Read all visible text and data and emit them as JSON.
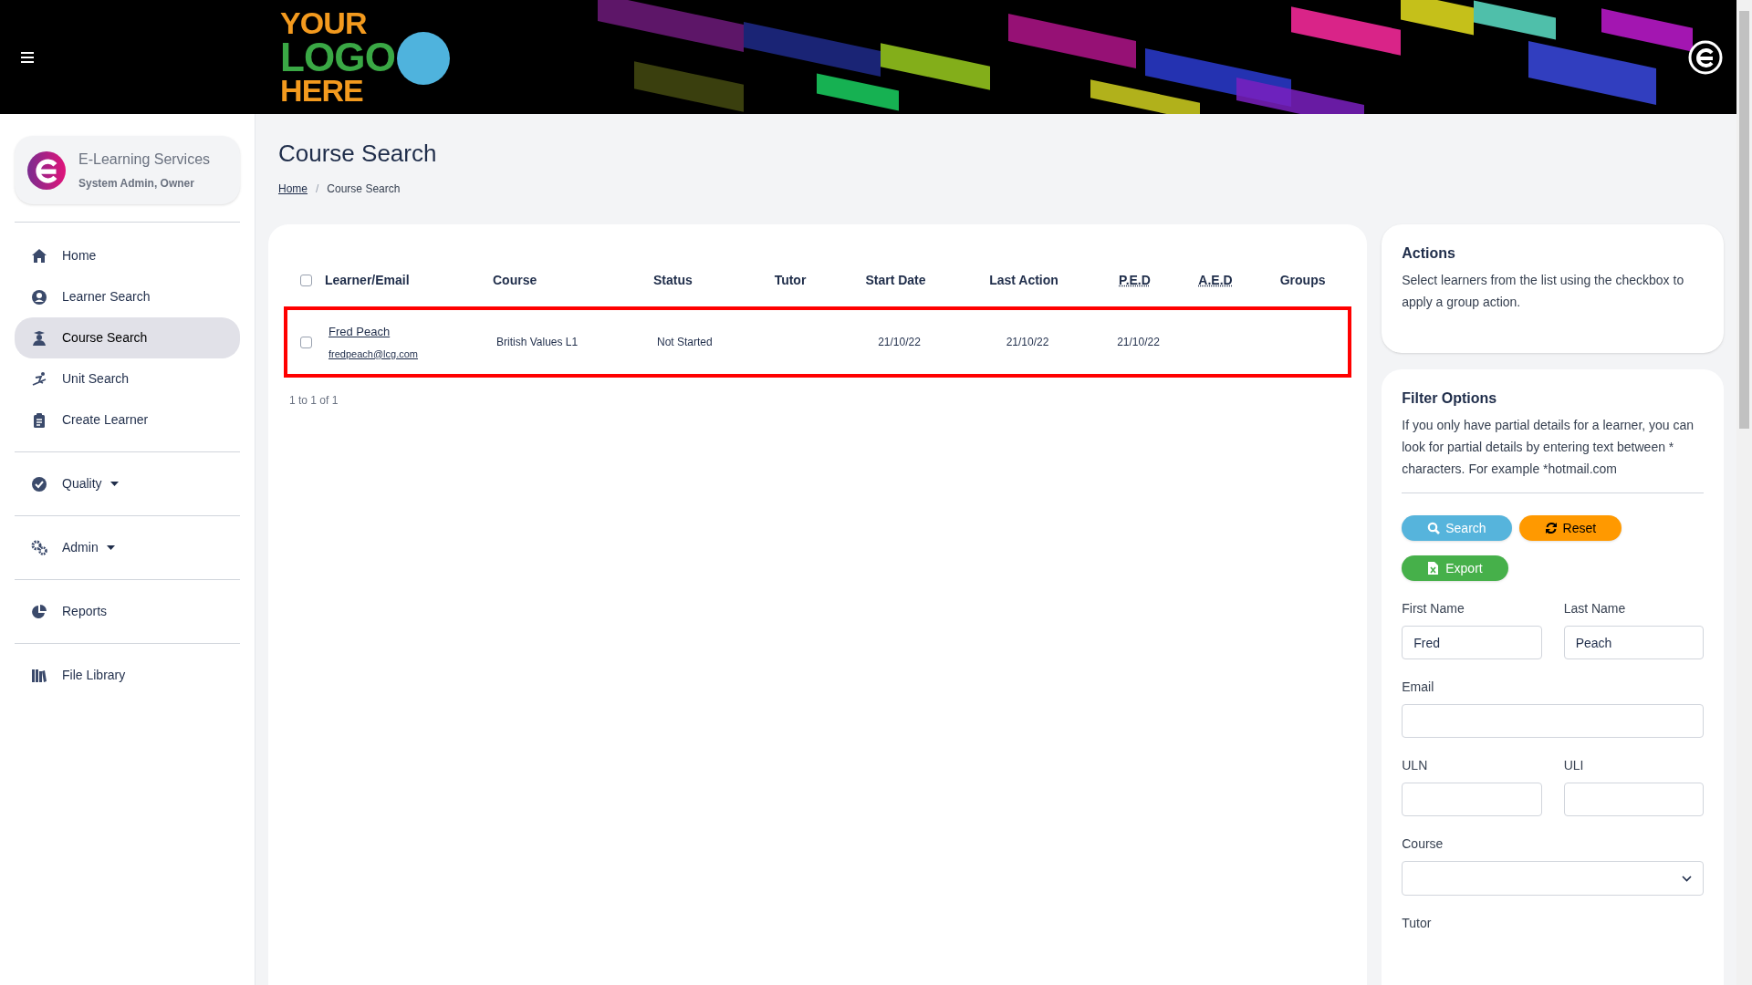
{
  "header": {
    "logo_lines": [
      "YOUR",
      "LOGO",
      "HERE"
    ]
  },
  "profile": {
    "name": "E-Learning Services",
    "role": "System Admin, Owner"
  },
  "sidebar": {
    "groups": [
      [
        {
          "label": "Home",
          "selected": false,
          "kind": "link"
        },
        {
          "label": "Learner Search",
          "selected": false,
          "kind": "link"
        },
        {
          "label": "Course Search",
          "selected": true,
          "kind": "link"
        },
        {
          "label": "Unit Search",
          "selected": false,
          "kind": "link"
        },
        {
          "label": "Create Learner",
          "selected": false,
          "kind": "link"
        }
      ],
      [
        {
          "label": "Quality",
          "selected": false,
          "kind": "dropdown"
        }
      ],
      [
        {
          "label": "Admin",
          "selected": false,
          "kind": "dropdown"
        }
      ],
      [
        {
          "label": "Reports",
          "selected": false,
          "kind": "link"
        }
      ],
      [
        {
          "label": "File Library",
          "selected": false,
          "kind": "link"
        }
      ]
    ]
  },
  "page": {
    "title": "Course Search",
    "breadcrumb": [
      {
        "label": "Home",
        "kind": "link"
      },
      {
        "label": "/",
        "kind": "separator"
      },
      {
        "label": "Course Search",
        "kind": "current"
      }
    ]
  },
  "table": {
    "select_all_checked": false,
    "columns": [
      {
        "label": "Learner/Email",
        "kind": "text"
      },
      {
        "label": "Course",
        "kind": "text"
      },
      {
        "label": "Status",
        "kind": "text"
      },
      {
        "label": "Tutor",
        "kind": "text"
      },
      {
        "label": "Start Date",
        "kind": "text"
      },
      {
        "label": "Last Action",
        "kind": "text"
      },
      {
        "label": "P.E.D",
        "kind": "abbr"
      },
      {
        "label": "A.E.D",
        "kind": "abbr"
      },
      {
        "label": "Groups",
        "kind": "text"
      }
    ],
    "rows": [
      {
        "checked": false,
        "highlighted": true,
        "name": "Fred Peach",
        "email": "fredpeach@lcg.com",
        "course": "British Values L1",
        "status": "Not Started",
        "start_date": "21/10/22",
        "last_action": "21/10/22",
        "ped": "21/10/22"
      }
    ],
    "pagination": "1 to 1 of 1"
  },
  "actions": {
    "title": "Actions",
    "text": "Select learners from the list using the checkbox to apply a group action."
  },
  "filter": {
    "title": "Filter Options",
    "text": "If you only have partial details for a learner, you can look for partial details by entering text between * characters. For example *hotmail.com",
    "buttons": [
      [
        {
          "label": "Search",
          "kind": "search"
        },
        {
          "label": "Reset",
          "kind": "reset"
        }
      ],
      [
        {
          "label": "Export",
          "kind": "export"
        }
      ]
    ],
    "field_rows": [
      [
        {
          "label": "First Name",
          "kind": "text",
          "value": "Fred"
        },
        {
          "label": "Last Name",
          "kind": "text",
          "value": "Peach"
        }
      ],
      [
        {
          "label": "Email",
          "kind": "text"
        }
      ],
      [
        {
          "label": "ULN",
          "kind": "text"
        },
        {
          "label": "ULI",
          "kind": "text"
        }
      ],
      [
        {
          "label": "Course",
          "kind": "select"
        }
      ],
      [
        {
          "label": "Tutor",
          "kind": "label_only"
        }
      ]
    ]
  }
}
